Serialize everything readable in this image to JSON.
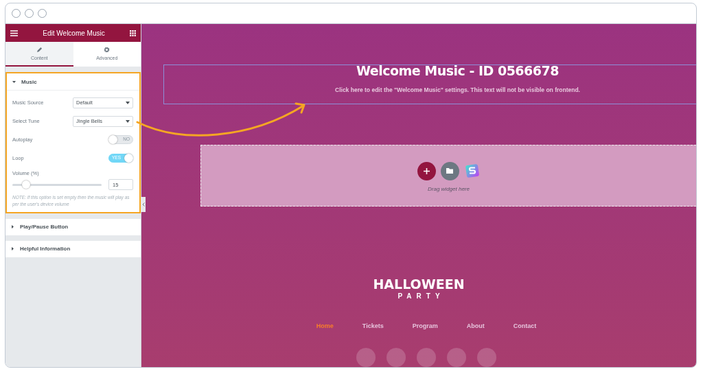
{
  "panel": {
    "title": "Edit Welcome Music",
    "tabs": [
      {
        "label": "Content",
        "selected": true
      },
      {
        "label": "Advanced",
        "selected": false
      }
    ],
    "sections": [
      {
        "title": "Music",
        "expanded": true,
        "highlighted": true,
        "controls": [
          {
            "kind": "select",
            "label": "Music Source",
            "value": "Default"
          },
          {
            "kind": "select",
            "label": "Select Tune",
            "value": "Jingle Bells"
          },
          {
            "kind": "toggle",
            "label": "Autoplay",
            "on": false,
            "text": "NO"
          },
          {
            "kind": "toggle",
            "label": "Loop",
            "on": true,
            "text": "YES"
          },
          {
            "kind": "slider",
            "label": "Volume (%)",
            "level": 0.15,
            "value": "15"
          },
          {
            "kind": "note",
            "text": "NOTE: If this option is set empty then the music will play as per the user's device volume"
          }
        ]
      },
      {
        "title": "Play/Pause Button",
        "expanded": false,
        "highlighted": false
      },
      {
        "title": "Helpful Information",
        "expanded": false,
        "highlighted": false
      }
    ]
  },
  "canvas": {
    "widget_title": "Welcome Music - ID 0566678",
    "widget_hint": "Click here to edit the \"Welcome Music\" settings. This text will not be visible on frontend.",
    "dropzone_hint": "Drag widget here",
    "logo": {
      "line_1": "HALLOWEEN",
      "line_2": "PARTY"
    },
    "nav": [
      {
        "label": "Home",
        "selected": true
      },
      {
        "label": "Tickets",
        "selected": false
      },
      {
        "label": "Program",
        "selected": false
      },
      {
        "label": "About",
        "selected": false
      },
      {
        "label": "Contact",
        "selected": false
      }
    ]
  }
}
